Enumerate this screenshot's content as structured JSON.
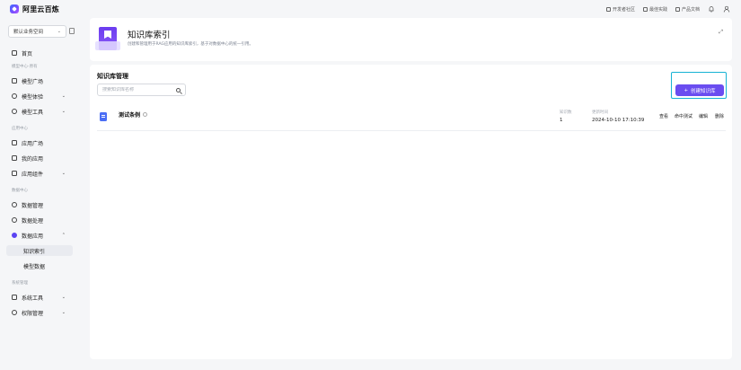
{
  "app": {
    "name": "阿里云百炼"
  },
  "topbar": {
    "links": [
      {
        "label": "开发者社区",
        "icon": "community-icon"
      },
      {
        "label": "最佳实践",
        "icon": "practice-icon"
      },
      {
        "label": "产品文档",
        "icon": "doc-icon"
      }
    ],
    "icons": [
      "bell-icon",
      "user-icon"
    ]
  },
  "sidebar": {
    "space": {
      "value": "默认业务空间"
    },
    "items": [
      {
        "label": "首页"
      },
      {
        "group": "模型中心-原有"
      },
      {
        "label": "模型广场"
      },
      {
        "label": "模型体验"
      },
      {
        "label": "模型工具"
      },
      {
        "group": "应用中心"
      },
      {
        "label": "应用广场"
      },
      {
        "label": "我的应用"
      },
      {
        "label": "应用组件"
      },
      {
        "group": "数据中心"
      },
      {
        "label": "数据管理"
      },
      {
        "label": "数据处理"
      },
      {
        "label": "数据应用"
      },
      {
        "label": "知识索引"
      },
      {
        "label": "模型数据"
      },
      {
        "group": "系统管理"
      },
      {
        "label": "系统工具"
      },
      {
        "label": "权限管理"
      }
    ]
  },
  "header": {
    "title": "知识库索引",
    "description": "创建和管理用于RAG应用的知识库索引，基于对数据中心的统一引用。"
  },
  "main": {
    "title": "知识库管理",
    "search_placeholder": "搜索知识库名称",
    "create_button": {
      "icon": "plus-icon",
      "label": "创建知识库"
    },
    "table": {
      "rows": [
        {
          "name": "测试条例",
          "count_label": "知识数",
          "count_value": "1",
          "time_label": "更新时间",
          "time_value": "2024-10-10 17:10:39",
          "actions": [
            "查看",
            "命中测试",
            "编辑",
            "删除"
          ]
        }
      ]
    }
  },
  "colors": {
    "accent": "#6a4df0",
    "highlight_border": "#17b3d4"
  }
}
